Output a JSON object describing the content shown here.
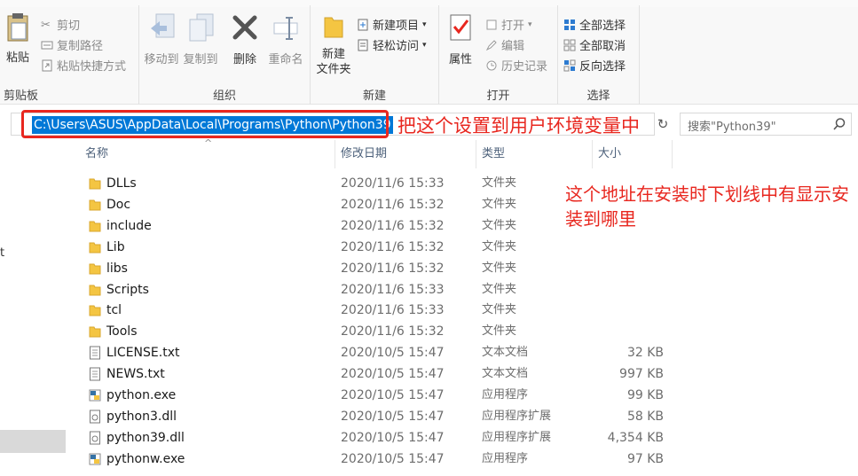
{
  "ribbon": {
    "clipboard": {
      "label": "剪贴板",
      "paste": "粘贴",
      "cut": "剪切",
      "copy_path": "复制路径",
      "paste_shortcut": "粘贴快捷方式"
    },
    "organize": {
      "label": "组织",
      "move_to": "移动到",
      "copy_to": "复制到",
      "delete": "删除",
      "rename": "重命名"
    },
    "new": {
      "label": "新建",
      "new_folder_line1": "新建",
      "new_folder_line2": "文件夹",
      "new_item": "新建项目",
      "easy_access": "轻松访问"
    },
    "open": {
      "label": "打开",
      "properties": "属性",
      "open": "打开",
      "edit": "编辑",
      "history": "历史记录"
    },
    "select": {
      "label": "选择",
      "select_all": "全部选择",
      "select_none": "全部取消",
      "invert": "反向选择"
    }
  },
  "address": {
    "path": "C:\\Users\\ASUS\\AppData\\Local\\Programs\\Python\\Python39",
    "annotation": "把这个设置到用户环境变量中"
  },
  "search": {
    "placeholder": "搜索\"Python39\""
  },
  "nav": {
    "partial_text": "t"
  },
  "columns": {
    "name": "名称",
    "date": "修改日期",
    "type": "类型",
    "size": "大小"
  },
  "files": [
    {
      "name": "DLLs",
      "date": "2020/11/6 15:33",
      "type": "文件夹",
      "size": "",
      "icon": "folder-icon"
    },
    {
      "name": "Doc",
      "date": "2020/11/6 15:32",
      "type": "文件夹",
      "size": "",
      "icon": "folder-icon"
    },
    {
      "name": "include",
      "date": "2020/11/6 15:32",
      "type": "文件夹",
      "size": "",
      "icon": "folder-icon"
    },
    {
      "name": "Lib",
      "date": "2020/11/6 15:32",
      "type": "文件夹",
      "size": "",
      "icon": "folder-icon"
    },
    {
      "name": "libs",
      "date": "2020/11/6 15:32",
      "type": "文件夹",
      "size": "",
      "icon": "folder-icon"
    },
    {
      "name": "Scripts",
      "date": "2020/11/6 15:33",
      "type": "文件夹",
      "size": "",
      "icon": "folder-icon"
    },
    {
      "name": "tcl",
      "date": "2020/11/6 15:33",
      "type": "文件夹",
      "size": "",
      "icon": "folder-icon"
    },
    {
      "name": "Tools",
      "date": "2020/11/6 15:32",
      "type": "文件夹",
      "size": "",
      "icon": "folder-icon"
    },
    {
      "name": "LICENSE.txt",
      "date": "2020/10/5 15:47",
      "type": "文本文档",
      "size": "32 KB",
      "icon": "text-file-icon"
    },
    {
      "name": "NEWS.txt",
      "date": "2020/10/5 15:47",
      "type": "文本文档",
      "size": "997 KB",
      "icon": "text-file-icon"
    },
    {
      "name": "python.exe",
      "date": "2020/10/5 15:47",
      "type": "应用程序",
      "size": "99 KB",
      "icon": "python-exe-icon"
    },
    {
      "name": "python3.dll",
      "date": "2020/10/5 15:47",
      "type": "应用程序扩展",
      "size": "58 KB",
      "icon": "dll-file-icon"
    },
    {
      "name": "python39.dll",
      "date": "2020/10/5 15:47",
      "type": "应用程序扩展",
      "size": "4,354 KB",
      "icon": "dll-file-icon"
    },
    {
      "name": "pythonw.exe",
      "date": "2020/10/5 15:47",
      "type": "应用程序",
      "size": "97 KB",
      "icon": "python-exe-icon"
    }
  ],
  "annotation_right": "这个地址在安装时下划线中有显示安装到哪里",
  "colors": {
    "annotation_red": "#e8271f",
    "selection_blue": "#0078d7",
    "folder_yellow": "#f4c542"
  }
}
